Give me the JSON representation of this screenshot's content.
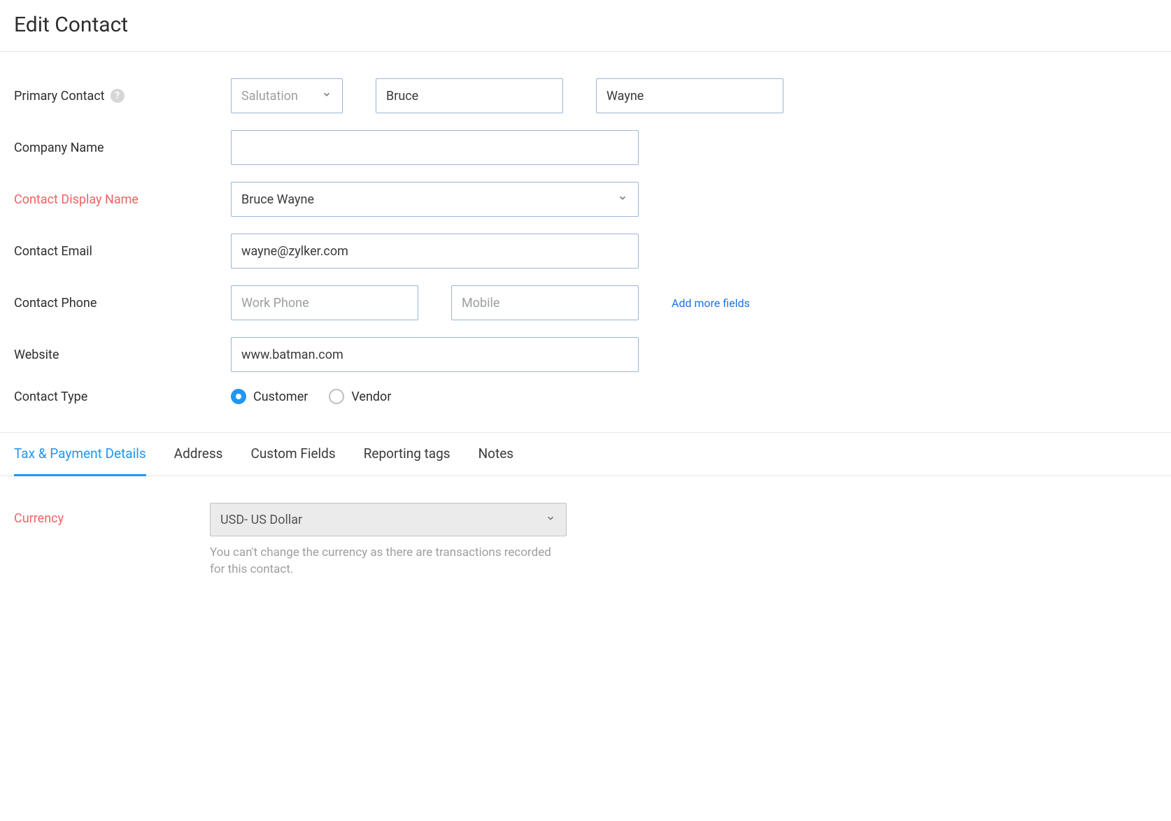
{
  "header": {
    "title": "Edit Contact"
  },
  "labels": {
    "primary_contact": "Primary Contact",
    "company_name": "Company Name",
    "contact_display_name": "Contact Display Name",
    "contact_email": "Contact Email",
    "contact_phone": "Contact Phone",
    "website": "Website",
    "contact_type": "Contact Type",
    "currency": "Currency"
  },
  "placeholders": {
    "salutation": "Salutation",
    "work_phone": "Work Phone",
    "mobile": "Mobile"
  },
  "values": {
    "first_name": "Bruce",
    "last_name": "Wayne",
    "company_name": "",
    "display_name": "Bruce Wayne",
    "email": "wayne@zylker.com",
    "work_phone": "",
    "mobile": "",
    "website": "www.batman.com",
    "currency": "USD- US Dollar"
  },
  "contact_type": {
    "selected": "customer",
    "options": {
      "customer": "Customer",
      "vendor": "Vendor"
    }
  },
  "links": {
    "add_more_fields": "Add more fields"
  },
  "tabs": [
    {
      "id": "tax-payment",
      "label": "Tax & Payment Details",
      "active": true
    },
    {
      "id": "address",
      "label": "Address",
      "active": false
    },
    {
      "id": "custom-fields",
      "label": "Custom Fields",
      "active": false
    },
    {
      "id": "reporting-tags",
      "label": "Reporting tags",
      "active": false
    },
    {
      "id": "notes",
      "label": "Notes",
      "active": false
    }
  ],
  "messages": {
    "currency_locked": "You can't change the currency as there are transactions recorded for this contact."
  }
}
